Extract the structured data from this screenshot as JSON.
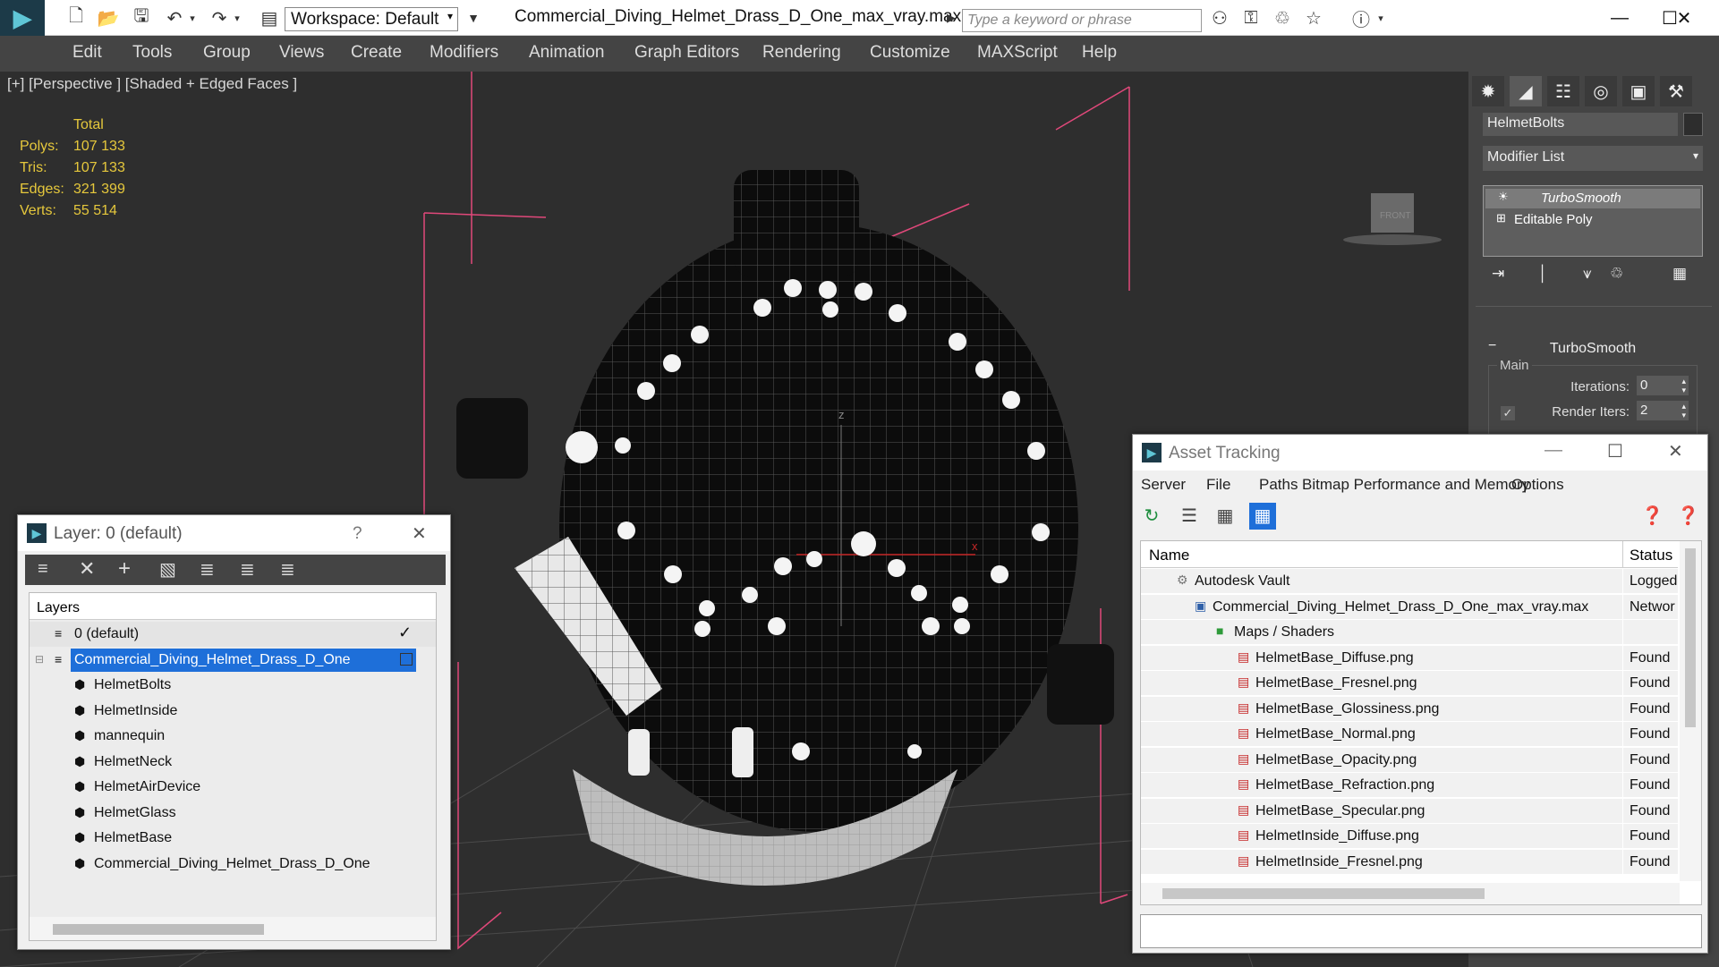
{
  "title_bar": {
    "workspace_label": "Workspace: Default",
    "document_title": "Commercial_Diving_Helmet_Drass_D_One_max_vray.max",
    "search_placeholder": "Type a keyword or phrase"
  },
  "menu": [
    "Edit",
    "Tools",
    "Group",
    "Views",
    "Create",
    "Modifiers",
    "Animation",
    "Graph Editors",
    "Rendering",
    "Customize",
    "MAXScript",
    "Help"
  ],
  "viewport": {
    "label": "[+] [Perspective ] [Shaded + Edged Faces ]",
    "stats_header": "Total",
    "stats": [
      {
        "label": "Polys:",
        "value": "107 133"
      },
      {
        "label": "Tris:",
        "value": "107 133"
      },
      {
        "label": "Edges:",
        "value": "321 399"
      },
      {
        "label": "Verts:",
        "value": "55 514"
      }
    ],
    "viewcube_label": "FRONT",
    "axis_z": "z",
    "axis_x": "x"
  },
  "command_panel": {
    "object_name": "HelmetBolts",
    "modifier_list": "Modifier List",
    "stack": [
      "TurboSmooth",
      "Editable Poly"
    ],
    "rollout_title": "TurboSmooth",
    "group_label": "Main",
    "iterations_label": "Iterations:",
    "iterations_value": "0",
    "render_iters_label": "Render Iters:",
    "render_iters_value": "2"
  },
  "layer_dialog": {
    "title": "Layer: 0 (default)",
    "help": "?",
    "column": "Layers",
    "rows": [
      {
        "name": "0 (default)",
        "level": 0
      },
      {
        "name": "Commercial_Diving_Helmet_Drass_D_One",
        "level": 0
      },
      {
        "name": "HelmetBolts",
        "level": 1
      },
      {
        "name": "HelmetInside",
        "level": 1
      },
      {
        "name": "mannequin",
        "level": 1
      },
      {
        "name": "HelmetNeck",
        "level": 1
      },
      {
        "name": "HelmetAirDevice",
        "level": 1
      },
      {
        "name": "HelmetGlass",
        "level": 1
      },
      {
        "name": "HelmetBase",
        "level": 1
      },
      {
        "name": "Commercial_Diving_Helmet_Drass_D_One",
        "level": 1
      }
    ]
  },
  "asset_dialog": {
    "title": "Asset Tracking",
    "menu": [
      "Server",
      "File",
      "Paths",
      "Bitmap Performance and Memory",
      "Options"
    ],
    "col_name": "Name",
    "col_status": "Status",
    "rows": [
      {
        "name": "Autodesk Vault",
        "status": "Logged",
        "level": 0
      },
      {
        "name": "Commercial_Diving_Helmet_Drass_D_One_max_vray.max",
        "status": "Networ",
        "level": 1
      },
      {
        "name": "Maps / Shaders",
        "status": "",
        "level": 2
      },
      {
        "name": "HelmetBase_Diffuse.png",
        "status": "Found",
        "level": 3
      },
      {
        "name": "HelmetBase_Fresnel.png",
        "status": "Found",
        "level": 3
      },
      {
        "name": "HelmetBase_Glossiness.png",
        "status": "Found",
        "level": 3
      },
      {
        "name": "HelmetBase_Normal.png",
        "status": "Found",
        "level": 3
      },
      {
        "name": "HelmetBase_Opacity.png",
        "status": "Found",
        "level": 3
      },
      {
        "name": "HelmetBase_Refraction.png",
        "status": "Found",
        "level": 3
      },
      {
        "name": "HelmetBase_Specular.png",
        "status": "Found",
        "level": 3
      },
      {
        "name": "HelmetInside_Diffuse.png",
        "status": "Found",
        "level": 3
      },
      {
        "name": "HelmetInside_Fresnel.png",
        "status": "Found",
        "level": 3
      }
    ]
  },
  "colors": {
    "accent": "#1e6fd9",
    "stats": "#e6c83c",
    "selection": "#1e6fd9"
  }
}
